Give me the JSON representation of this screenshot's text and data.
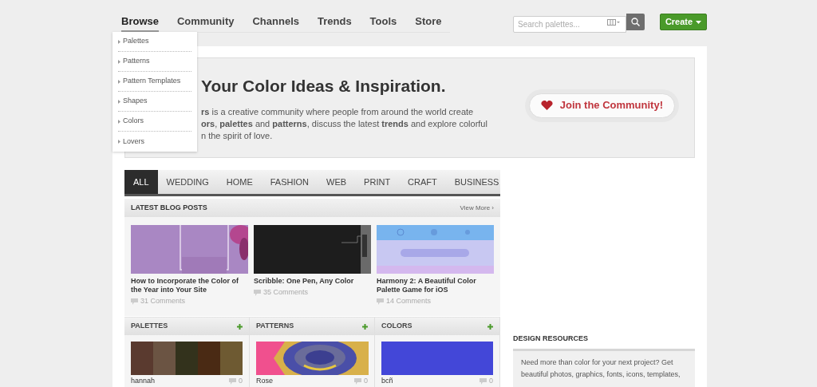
{
  "nav": {
    "items": [
      {
        "label": "Browse",
        "selected": true
      },
      {
        "label": "Community",
        "selected": false
      },
      {
        "label": "Channels",
        "selected": false
      },
      {
        "label": "Trends",
        "selected": false
      },
      {
        "label": "Tools",
        "selected": false
      },
      {
        "label": "Store",
        "selected": false
      }
    ],
    "dropdown": [
      "Palettes",
      "Patterns",
      "Pattern Templates",
      "Shapes",
      "Colors",
      "Lovers"
    ]
  },
  "search": {
    "placeholder": "Search palettes..."
  },
  "create_button": "Create",
  "hero": {
    "heading": "Your Color Ideas & Inspiration.",
    "lines": [
      "**rs** is a creative community where people from around the world create",
      "**ors**, **palettes** and **patterns**, discuss the latest **trends** and explore colorful",
      "n the spirit of love."
    ],
    "join_button": "Join the Community!"
  },
  "filter_tabs": [
    {
      "label": "ALL",
      "selected": true
    },
    {
      "label": "WEDDING",
      "selected": false
    },
    {
      "label": "HOME",
      "selected": false
    },
    {
      "label": "FASHION",
      "selected": false
    },
    {
      "label": "WEB",
      "selected": false
    },
    {
      "label": "PRINT",
      "selected": false
    },
    {
      "label": "CRAFT",
      "selected": false
    },
    {
      "label": "BUSINESS",
      "selected": false
    }
  ],
  "blog": {
    "title": "LATEST BLOG POSTS",
    "view_more": "View More ›",
    "posts": [
      {
        "title": "How to Incorporate the Color of the Year into Your Site",
        "comments": "31 Comments",
        "kind": "purple"
      },
      {
        "title": "Scribble: One Pen, Any Color",
        "comments": "35 Comments",
        "kind": "dark"
      },
      {
        "title": "Harmony 2: A Beautiful Color Palette Game for iOS",
        "comments": "14 Comments",
        "kind": "blue"
      }
    ]
  },
  "sections": [
    {
      "title": "PALETTES",
      "kind": "palette",
      "item": "hannah",
      "comments": "0"
    },
    {
      "title": "PATTERNS",
      "kind": "pattern",
      "item": "Rose",
      "comments": "0"
    },
    {
      "title": "COLORS",
      "kind": "color",
      "item": "bcñ",
      "comments": "0"
    }
  ],
  "design_resources": {
    "title": "DESIGN RESOURCES",
    "lines": [
      "Need more than color for your next project? Get",
      "beautiful photos, graphics, fonts, icons, templates,"
    ]
  }
}
